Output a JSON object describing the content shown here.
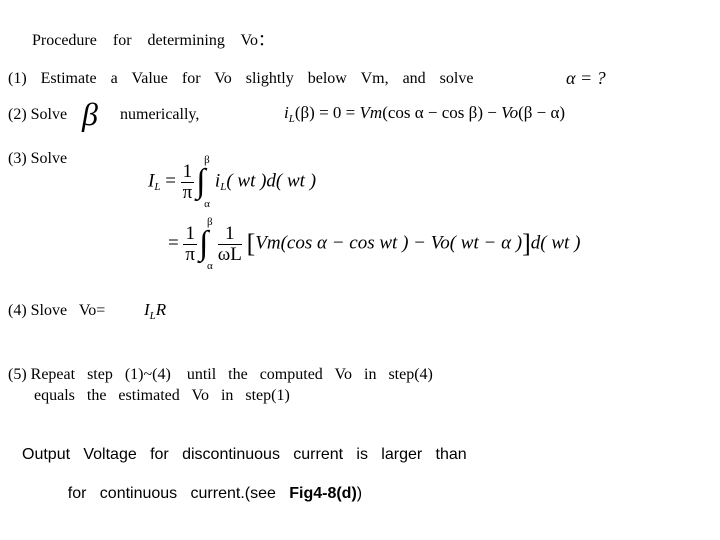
{
  "heading": "Procedure  for  determining  Vo：",
  "steps": [
    {
      "label": "(1) Estimate  a  Value  for  Vo  slightly  below  Vm, and  solve",
      "math": "α = ?"
    },
    {
      "label_pre": "(2) Solve",
      "symbol": "β",
      "label_post": "numerically,",
      "equation": {
        "lhs": "i",
        "lhs_sub": "L",
        "arg": "(β) = 0 = ",
        "vm": "Vm",
        "mid": "(cos α − cos β) − ",
        "vo": "Vo",
        "tail": "(β − α)"
      }
    },
    {
      "label": "(3) Solve",
      "eq1": {
        "lhs": "I",
        "lhs_sub": "L",
        "equals": "=",
        "frac_num": "1",
        "frac_den": "π",
        "upper": "β",
        "lower": "α",
        "integrand": "i",
        "integrand_sub": "L",
        "body": "( wt )d( wt )"
      },
      "eq2": {
        "equals": "=",
        "frac_num": "1",
        "frac_den": "π",
        "upper": "β",
        "lower": "α",
        "frac2_num": "1",
        "frac2_den": "ωL",
        "body": "Vm(cos α − cos wt ) − Vo( wt − α )",
        "tail": "d( wt )"
      }
    },
    {
      "label": "(4) Slove   Vo=",
      "math": "I",
      "math_sub": "L",
      "math_tail": "R"
    },
    {
      "line1": "(5) Repeat   step   (1)~(4)    until   the   computed   Vo   in   step(4)",
      "line2": "equals   the   estimated   Vo   in   step(1)"
    }
  ],
  "conclusion": {
    "line1": "Output   Voltage   for   discontinuous   current   is   larger   than",
    "line2_pre": "for   continuous   current.(see",
    "line2_bold": "Fig4-8(d)",
    "line2_post": ")"
  }
}
